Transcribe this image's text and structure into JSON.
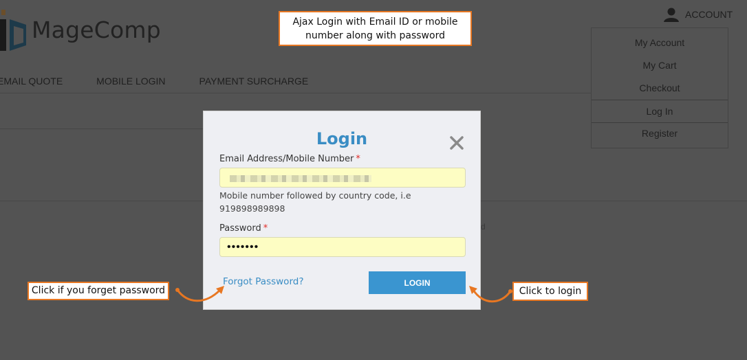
{
  "brand": {
    "name": "MageComp"
  },
  "header": {
    "account_label": "ACCOUNT"
  },
  "nav": {
    "items": [
      "EMAIL QUOTE",
      "MOBILE LOGIN",
      "PAYMENT SURCHARGE"
    ]
  },
  "account_menu": {
    "items": [
      "My Account",
      "My Cart",
      "Checkout",
      "Log In",
      "Register"
    ],
    "active": "Log In"
  },
  "login_modal": {
    "title": "Login",
    "email_label": "Email Address/Mobile Number",
    "required_mark": "*",
    "email_note": "Mobile number followed by country code, i.e 919898989898",
    "password_label": "Password",
    "password_value": "•••••••",
    "forgot_link": "Forgot Password?",
    "login_button": "LOGIN"
  },
  "callouts": {
    "top": "Ajax Login with Email ID or mobile number along with password",
    "left": "Click if you forget password",
    "right": "Click to login"
  },
  "colors": {
    "accent": "#3a8dc4",
    "button": "#3a95d0",
    "callout_border": "#e87722",
    "input_bg": "#fdfdc3",
    "overlay": "#535353"
  },
  "icons": [
    "user-icon",
    "close-icon",
    "curved-arrow-icon"
  ]
}
